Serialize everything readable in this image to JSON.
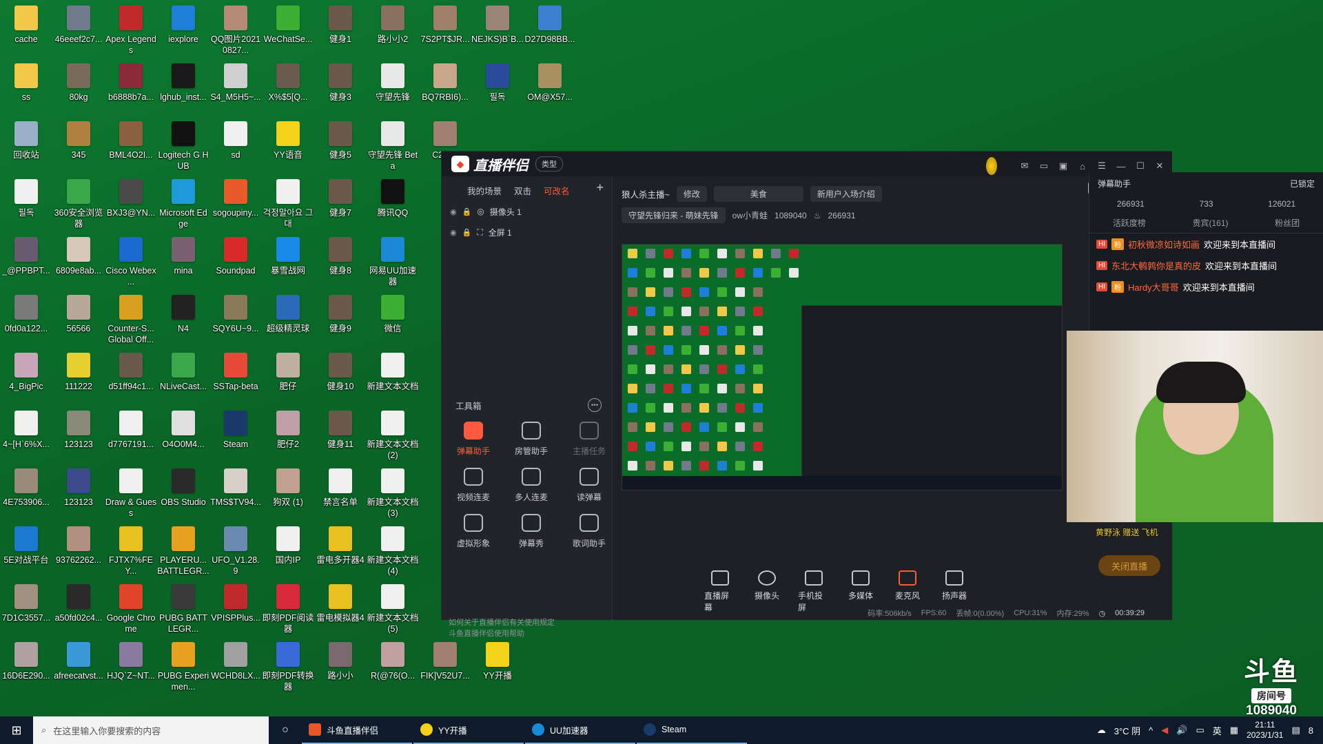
{
  "desktop": {
    "icons": [
      {
        "label": "cache",
        "color": "#f2c84b",
        "col": 0,
        "row": 0
      },
      {
        "label": "46eeef2c7...",
        "color": "#6f7a8a",
        "col": 1,
        "row": 0
      },
      {
        "label": "Apex Legends",
        "color": "#c02a2a",
        "col": 2,
        "row": 0
      },
      {
        "label": "iexplore",
        "color": "#1e7fd8",
        "col": 3,
        "row": 0
      },
      {
        "label": "QQ图片20210827...",
        "color": "#b58a77",
        "col": 4,
        "row": 0
      },
      {
        "label": "WeChatSe...",
        "color": "#3cb034",
        "col": 5,
        "row": 0
      },
      {
        "label": "健身1",
        "color": "#6b5a4a",
        "col": 6,
        "row": 0
      },
      {
        "label": "路小小2",
        "color": "#8a7060",
        "col": 7,
        "row": 0
      },
      {
        "label": "7S2PT$JR...",
        "color": "#a07f6a",
        "col": 8,
        "row": 0
      },
      {
        "label": "NEJKS)B`B...",
        "color": "#9a8377",
        "col": 9,
        "row": 0
      },
      {
        "label": "D27D98BB...",
        "color": "#3a7fd0",
        "col": 10,
        "row": 0
      },
      {
        "label": "ss",
        "color": "#f2c84b",
        "col": 0,
        "row": 1
      },
      {
        "label": "80kg",
        "color": "#7a6a5a",
        "col": 1,
        "row": 1
      },
      {
        "label": "b6888b7a...",
        "color": "#8a2a3a",
        "col": 2,
        "row": 1
      },
      {
        "label": "lghub_inst...",
        "color": "#1a1a1a",
        "col": 3,
        "row": 1
      },
      {
        "label": "S4_M5H5~...",
        "color": "#cfcfcf",
        "col": 4,
        "row": 1
      },
      {
        "label": "X%$5[Q...",
        "color": "#6a5a50",
        "col": 5,
        "row": 1
      },
      {
        "label": "健身3",
        "color": "#6b5a4a",
        "col": 6,
        "row": 1
      },
      {
        "label": "守望先锋",
        "color": "#e8e8e8",
        "col": 7,
        "row": 1
      },
      {
        "label": "BQ7RBI6)...",
        "color": "#c9a58a",
        "col": 8,
        "row": 1
      },
      {
        "label": "필독",
        "color": "#2a4a9a",
        "col": 9,
        "row": 1
      },
      {
        "label": "OM@X57...",
        "color": "#a89060",
        "col": 10,
        "row": 1
      },
      {
        "label": "回收站",
        "color": "#9ab0c8",
        "col": 0,
        "row": 2
      },
      {
        "label": "345",
        "color": "#b08040",
        "col": 1,
        "row": 2
      },
      {
        "label": "BML4O2I...",
        "color": "#8a6040",
        "col": 2,
        "row": 2
      },
      {
        "label": "Logitech G HUB",
        "color": "#111111",
        "col": 3,
        "row": 2
      },
      {
        "label": "sd",
        "color": "#f0f0f0",
        "col": 4,
        "row": 2
      },
      {
        "label": "YY语音",
        "color": "#f4d21c",
        "col": 5,
        "row": 2
      },
      {
        "label": "健身5",
        "color": "#6b5a4a",
        "col": 6,
        "row": 2
      },
      {
        "label": "守望先锋 Beta",
        "color": "#e8e8e8",
        "col": 7,
        "row": 2
      },
      {
        "label": "C2(2...",
        "color": "#a08070",
        "col": 8,
        "row": 2
      },
      {
        "label": "필독",
        "color": "#f0f0f0",
        "col": 0,
        "row": 3
      },
      {
        "label": "360安全浏览器",
        "color": "#3aa84a",
        "col": 1,
        "row": 3
      },
      {
        "label": "BXJ3@YN...",
        "color": "#4a4a4a",
        "col": 2,
        "row": 3
      },
      {
        "label": "Microsoft Edge",
        "color": "#1f9ad8",
        "col": 3,
        "row": 3
      },
      {
        "label": "sogoupiny...",
        "color": "#e85a2a",
        "col": 4,
        "row": 3
      },
      {
        "label": "걱정말아요 그대",
        "color": "#f0f0f0",
        "col": 5,
        "row": 3
      },
      {
        "label": "健身7",
        "color": "#6b5a4a",
        "col": 6,
        "row": 3
      },
      {
        "label": "腾讯QQ",
        "color": "#111111",
        "col": 7,
        "row": 3
      },
      {
        "label": "_@PPBPT...",
        "color": "#6a5a70",
        "col": 0,
        "row": 4
      },
      {
        "label": "6809e8ab...",
        "color": "#d8c8b8",
        "col": 1,
        "row": 4
      },
      {
        "label": "Cisco Webex ...",
        "color": "#1a6ad0",
        "col": 2,
        "row": 4
      },
      {
        "label": "mina",
        "color": "#7a6070",
        "col": 3,
        "row": 4
      },
      {
        "label": "Soundpad",
        "color": "#d82a2a",
        "col": 4,
        "row": 4
      },
      {
        "label": "暴雪战网",
        "color": "#1a8ae8",
        "col": 5,
        "row": 4
      },
      {
        "label": "健身8",
        "color": "#6b5a4a",
        "col": 6,
        "row": 4
      },
      {
        "label": "网易UU加速器",
        "color": "#1a8ad8",
        "col": 7,
        "row": 4
      },
      {
        "label": "0fd0a122...",
        "color": "#7a7a7a",
        "col": 0,
        "row": 5
      },
      {
        "label": "56566",
        "color": "#b8a898",
        "col": 1,
        "row": 5
      },
      {
        "label": "Counter-S... Global Off...",
        "color": "#d8a020",
        "col": 2,
        "row": 5
      },
      {
        "label": "N4",
        "color": "#222222",
        "col": 3,
        "row": 5
      },
      {
        "label": "SQY6U~9...",
        "color": "#8a7a5a",
        "col": 4,
        "row": 5
      },
      {
        "label": "超级精灵球",
        "color": "#2a6ab8",
        "col": 5,
        "row": 5
      },
      {
        "label": "健身9",
        "color": "#6b5a4a",
        "col": 6,
        "row": 5
      },
      {
        "label": "微信",
        "color": "#3cb034",
        "col": 7,
        "row": 5
      },
      {
        "label": "4_BigPic",
        "color": "#c8a8b8",
        "col": 0,
        "row": 6
      },
      {
        "label": "111222",
        "color": "#e8d030",
        "col": 1,
        "row": 6
      },
      {
        "label": "d51ff94c1...",
        "color": "#6a5a4a",
        "col": 2,
        "row": 6
      },
      {
        "label": "NLiveCast...",
        "color": "#3aa84a",
        "col": 3,
        "row": 6
      },
      {
        "label": "SSTap-beta",
        "color": "#e84a3a",
        "col": 4,
        "row": 6
      },
      {
        "label": "肥仔",
        "color": "#c0b0a0",
        "col": 5,
        "row": 6
      },
      {
        "label": "健身10",
        "color": "#6b5a4a",
        "col": 6,
        "row": 6
      },
      {
        "label": "新建文本文档",
        "color": "#f0f0f0",
        "col": 7,
        "row": 6
      },
      {
        "label": "4~[H`6%X...",
        "color": "#f0f0f0",
        "col": 0,
        "row": 7
      },
      {
        "label": "123123",
        "color": "#8a8a7a",
        "col": 1,
        "row": 7
      },
      {
        "label": "d7767191...",
        "color": "#f0f0f0",
        "col": 2,
        "row": 7
      },
      {
        "label": "O4O0M4...",
        "color": "#e0e0e0",
        "col": 3,
        "row": 7
      },
      {
        "label": "Steam",
        "color": "#1a3a6a",
        "col": 4,
        "row": 7
      },
      {
        "label": "肥仔2",
        "color": "#c0a0a8",
        "col": 5,
        "row": 7
      },
      {
        "label": "健身11",
        "color": "#6b5a4a",
        "col": 6,
        "row": 7
      },
      {
        "label": "新建文本文档 (2)",
        "color": "#f0f0f0",
        "col": 7,
        "row": 7
      },
      {
        "label": "4E753906...",
        "color": "#9a8a7a",
        "col": 0,
        "row": 8
      },
      {
        "label": "123123",
        "color": "#3a4a8a",
        "col": 1,
        "row": 8
      },
      {
        "label": "Draw & Guess",
        "color": "#f0f0f0",
        "col": 2,
        "row": 8
      },
      {
        "label": "OBS Studio",
        "color": "#2a2a2a",
        "col": 3,
        "row": 8
      },
      {
        "label": "TMS$TV94...",
        "color": "#d8d0c8",
        "col": 4,
        "row": 8
      },
      {
        "label": "狗双 (1)",
        "color": "#c0a090",
        "col": 5,
        "row": 8
      },
      {
        "label": "禁言名单",
        "color": "#f0f0f0",
        "col": 6,
        "row": 8
      },
      {
        "label": "新建文本文档 (3)",
        "color": "#f0f0f0",
        "col": 7,
        "row": 8
      },
      {
        "label": "5E对战平台",
        "color": "#1a7ad0",
        "col": 0,
        "row": 9
      },
      {
        "label": "93762262...",
        "color": "#b09080",
        "col": 1,
        "row": 9
      },
      {
        "label": "FJTX7%FEY...",
        "color": "#e8c020",
        "col": 2,
        "row": 9
      },
      {
        "label": "PLAYERU... BATTLEGR...",
        "color": "#e8a020",
        "col": 3,
        "row": 9
      },
      {
        "label": "UFO_V1.28.9",
        "color": "#6a8ab0",
        "col": 4,
        "row": 9
      },
      {
        "label": "国内IP",
        "color": "#f0f0f0",
        "col": 5,
        "row": 9
      },
      {
        "label": "雷电多开器4",
        "color": "#e8c020",
        "col": 6,
        "row": 9
      },
      {
        "label": "新建文本文档 (4)",
        "color": "#f0f0f0",
        "col": 7,
        "row": 9
      },
      {
        "label": "7D1C3557...",
        "color": "#a09080",
        "col": 0,
        "row": 10
      },
      {
        "label": "a50fd02c4...",
        "color": "#2a2a2a",
        "col": 1,
        "row": 10
      },
      {
        "label": "Google Chrome",
        "color": "#e0452a",
        "col": 2,
        "row": 10
      },
      {
        "label": "PUBG BATTLEGR...",
        "color": "#3a3a3a",
        "col": 3,
        "row": 10
      },
      {
        "label": "VPISPPlus...",
        "color": "#c02a2a",
        "col": 4,
        "row": 10
      },
      {
        "label": "即刻PDF阅读器",
        "color": "#d82a3a",
        "col": 5,
        "row": 10
      },
      {
        "label": "雷电模拟器4",
        "color": "#e8c020",
        "col": 6,
        "row": 10
      },
      {
        "label": "新建文本文档 (5)",
        "color": "#f0f0f0",
        "col": 7,
        "row": 10
      },
      {
        "label": "16D6E290...",
        "color": "#b0a0a0",
        "col": 0,
        "row": 11
      },
      {
        "label": "afreecatvst...",
        "color": "#3a9ad8",
        "col": 1,
        "row": 11
      },
      {
        "label": "HJQ`Z~NT...",
        "color": "#8a7aa0",
        "col": 2,
        "row": 11
      },
      {
        "label": "PUBG Experimen...",
        "color": "#e8a020",
        "col": 3,
        "row": 11
      },
      {
        "label": "WCHD8LX...",
        "color": "#a0a0a0",
        "col": 4,
        "row": 11
      },
      {
        "label": "即刻PDF转换器",
        "color": "#3a6ad8",
        "col": 5,
        "row": 11
      },
      {
        "label": "路小小",
        "color": "#7a6a70",
        "col": 6,
        "row": 11
      },
      {
        "label": "R(@76(O...",
        "color": "#c0a0a0",
        "col": 7,
        "row": 11
      },
      {
        "label": "FIK]V52U7...",
        "color": "#a08070",
        "col": 8,
        "row": 11
      },
      {
        "label": "YY开播",
        "color": "#f4d21c",
        "col": 9,
        "row": 11
      }
    ]
  },
  "app": {
    "logo": "直播伴侣",
    "type_btn": "类型",
    "left": {
      "tabs": [
        "我的场景",
        "双击",
        "可改名"
      ],
      "scenes": [
        "摄像头 1",
        "全屏 1"
      ],
      "toolbox_title": "工具箱",
      "tools": [
        "弹幕助手",
        "房管助手",
        "主播任务",
        "视频连麦",
        "多人连麦",
        "读弹幕",
        "虚拟形象",
        "弹幕秀",
        "歌词助手"
      ],
      "notice1": "如何关于直播伴侣有关使用规定",
      "notice2": "斗鱼直播伴侣使用帮助"
    },
    "center": {
      "room_title": "狼人杀主播~",
      "edit": "修改",
      "category": "美食",
      "new_user": "新用户入场介绍",
      "announcement": "守望先锋归来 - 萌妹先锋",
      "user": "ow小青蛙",
      "room_id": "1089040",
      "hot": "266931",
      "controls": [
        "直播屏幕",
        "摄像头",
        "手机投屏",
        "多媒体",
        "麦克风",
        "扬声器"
      ],
      "end_live": "关闭直播",
      "status": [
        "码率:506kb/s",
        "FPS:60",
        "丢帧:0(0.00%)",
        "CPU:31%",
        "内存:29%"
      ],
      "duration": "00:39:29"
    }
  },
  "danmu": {
    "title": "弹幕助手",
    "locked": "已锁定",
    "stats": [
      "266931",
      "733",
      "126021"
    ],
    "tabs": [
      "活跃度榜",
      "贵宾(161)",
      "粉丝团"
    ],
    "messages": [
      {
        "name": "初秋微凉如诗如画",
        "text": "欢迎来到本直播间"
      },
      {
        "name": "东北大鹌鹑你是真的皮",
        "text": "欢迎来到本直播间"
      },
      {
        "name": "Hardy大哥哥",
        "text": "欢迎来到本直播间"
      }
    ],
    "gift": "黄野泳 赠送 飞机"
  },
  "overlay": {
    "brand": "斗鱼",
    "room_label": "房间号",
    "room_id": "1089040"
  },
  "taskbar": {
    "search_placeholder": "在这里输入你要搜索的内容",
    "apps": [
      {
        "label": "斗鱼直播伴侣",
        "color": "#e8572a"
      },
      {
        "label": "YY开播",
        "color": "#f4d21c"
      },
      {
        "label": "UU加速器",
        "color": "#1a8ad8"
      },
      {
        "label": "Steam",
        "color": "#1a3a6a"
      }
    ],
    "weather": "3°C 阴",
    "ime": "英",
    "time": "21:11",
    "date": "2023/1/31",
    "notif_count": "8"
  }
}
